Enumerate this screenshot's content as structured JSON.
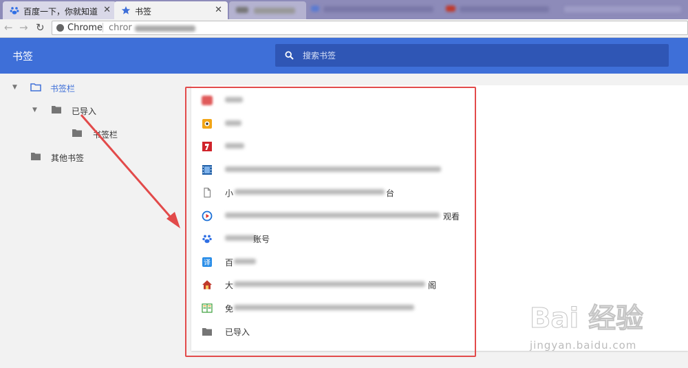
{
  "tabs": [
    {
      "title": "百度一下，你就知道",
      "close": "✕"
    },
    {
      "title": "书签",
      "close": "✕"
    }
  ],
  "omnibox": {
    "site_label": "Chrome",
    "url": "chror"
  },
  "header": {
    "title": "书签",
    "search_placeholder": "搜索书签"
  },
  "sidebar": {
    "items": [
      {
        "label": "书签栏",
        "selected": true
      },
      {
        "label": "已导入"
      },
      {
        "label": "书签栏"
      },
      {
        "label": "其他书签"
      }
    ]
  },
  "bookmarks": [
    {
      "icon": "red-blur-icon",
      "text": "",
      "color": "#e05a5a"
    },
    {
      "icon": "orange-face-icon",
      "text": "",
      "color": "#f2a516"
    },
    {
      "icon": "red-number-icon",
      "text": "",
      "color": "#d0242b"
    },
    {
      "icon": "film-strip-icon",
      "text": "",
      "color": "#1f5fa8"
    },
    {
      "icon": "document-icon",
      "text": "小",
      "color": "#888888"
    },
    {
      "icon": "play-circle-icon",
      "text": "观看",
      "color": "#1b6fd6"
    },
    {
      "icon": "baidu-paw-icon",
      "text": "账号",
      "color": "#2f6fe4"
    },
    {
      "icon": "translate-icon",
      "text": "百",
      "color": "#2b8ee8"
    },
    {
      "icon": "house-icon",
      "text": "大",
      "color": "#c0392b"
    },
    {
      "icon": "book-icon",
      "text": "免",
      "color": "#3a9e3a"
    },
    {
      "icon": "folder-icon",
      "text": "已导入",
      "color": "#757575"
    }
  ],
  "watermark": {
    "main": "Bai 经验",
    "sub": "jingyan.baidu.com"
  }
}
